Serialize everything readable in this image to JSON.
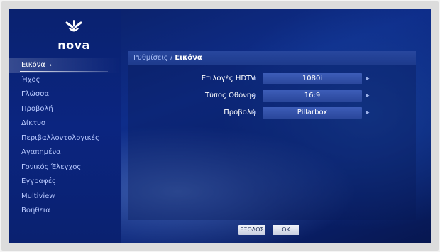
{
  "brand": {
    "logo_text": "nova"
  },
  "sidebar": {
    "items": [
      {
        "label": "Εικόνα",
        "active": true
      },
      {
        "label": "Ήχος"
      },
      {
        "label": "Γλώσσα"
      },
      {
        "label": "Προβολή"
      },
      {
        "label": "Δίκτυο"
      },
      {
        "label": "Περιβαλλοντολογικές"
      },
      {
        "label": "Αγαπημένα"
      },
      {
        "label": "Γονικός Έλεγχος"
      },
      {
        "label": "Εγγραφές"
      },
      {
        "label": "Multiview"
      },
      {
        "label": "Βοήθεια"
      }
    ]
  },
  "breadcrumb": {
    "root": "Ρυθμίσεις",
    "separator": " / ",
    "current": "Εικόνα"
  },
  "settings": {
    "rows": [
      {
        "label": "Επιλογές HDTV",
        "value": "1080i"
      },
      {
        "label": "Τύπος Οθόνης",
        "value": "16:9"
      },
      {
        "label": "Προβολή",
        "value": "Pillarbox"
      }
    ]
  },
  "buttons": {
    "exit": "ΕΞΟΔΟΣ",
    "ok": "OK"
  },
  "icons": {
    "left": "left-arrow-icon",
    "right": "right-arrow-icon",
    "logo": "nova-logo-icon"
  },
  "colors": {
    "accent": "#1d3a8c",
    "background": "#0e2d8a",
    "text": "#ffffff"
  }
}
